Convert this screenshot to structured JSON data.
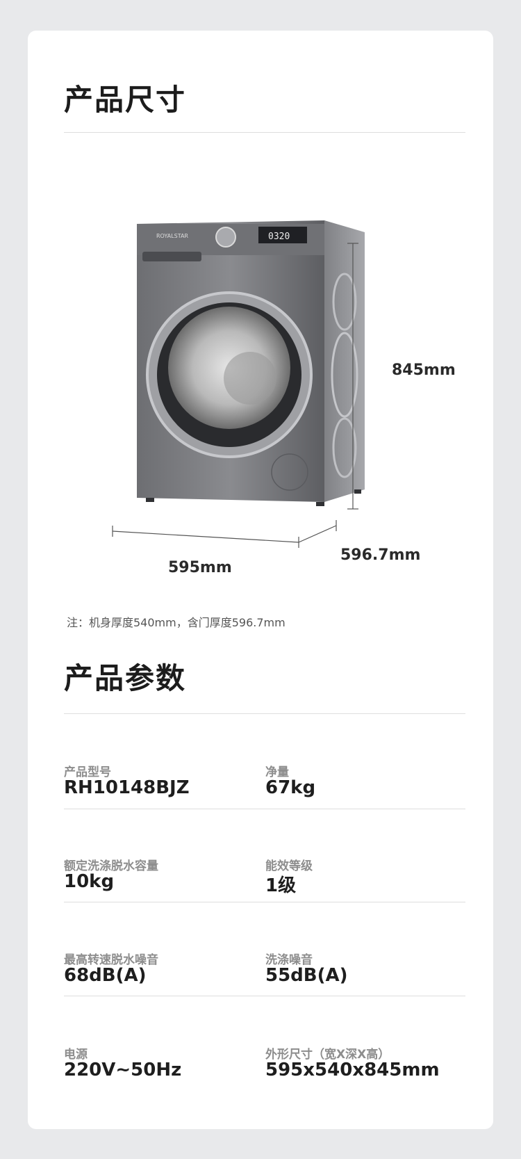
{
  "dimensions": {
    "title": "产品尺寸",
    "height_label": "845mm",
    "width_label": "595mm",
    "depth_label": "596.7mm",
    "note": "注：机身厚度540mm，含门厚度596.7mm",
    "display_time": "0320"
  },
  "params": {
    "title": "产品参数",
    "rows": [
      [
        {
          "label": "产品型号",
          "value": "RH10148BJZ"
        },
        {
          "label": "净量",
          "value": "67kg"
        }
      ],
      [
        {
          "label": "额定洗涤脱水容量",
          "value": "10kg"
        },
        {
          "label": "能效等级",
          "value": "1级"
        }
      ],
      [
        {
          "label": "最高转速脱水噪音",
          "value": "68dB(A)"
        },
        {
          "label": "洗涤噪音",
          "value": "55dB(A)"
        }
      ],
      [
        {
          "label": "电源",
          "value": "220V~50Hz"
        },
        {
          "label": "外形尺寸（宽X深X高）",
          "value": "595x540x845mm"
        }
      ]
    ]
  }
}
